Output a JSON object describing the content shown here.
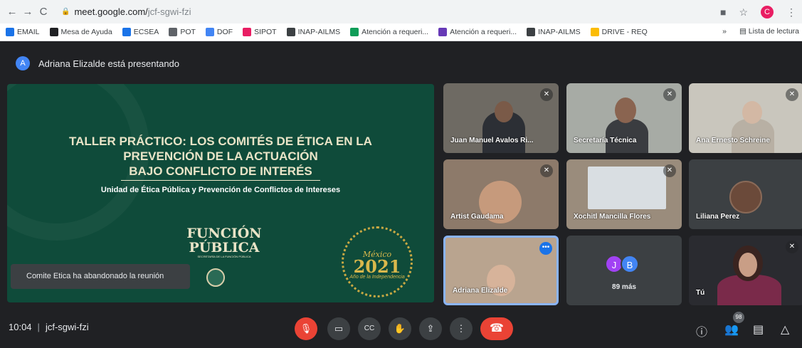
{
  "browser": {
    "url_domain": "meet.google.com/",
    "url_path": "jcf-sgwi-fzi",
    "profile_initial": "C"
  },
  "bookmarks": [
    {
      "label": "EMAIL",
      "color": "#1a73e8"
    },
    {
      "label": "Mesa de Ayuda",
      "color": "#202124"
    },
    {
      "label": "ECSEA",
      "color": "#1a73e8"
    },
    {
      "label": "POT",
      "color": "#5f6368"
    },
    {
      "label": "DOF",
      "color": "#4285f4"
    },
    {
      "label": "SIPOT",
      "color": "#e91e63"
    },
    {
      "label": "INAP-AILMS",
      "color": "#3c4043"
    },
    {
      "label": "Atención a requeri...",
      "color": "#0f9d58"
    },
    {
      "label": "Atención a requeri...",
      "color": "#673ab7"
    },
    {
      "label": "INAP-AILMS",
      "color": "#3c4043"
    },
    {
      "label": "DRIVE - REQ",
      "color": "#fbbc04"
    }
  ],
  "bookmarks_right": {
    "more": "»",
    "reading_list": "Lista de lectura"
  },
  "presenter": {
    "initial": "A",
    "text": "Adriana Elizalde está presentando"
  },
  "slide": {
    "title_lines": [
      "TALLER PRÁCTICO: LOS COMITÉS DE ÉTICA EN LA",
      "PREVENCIÓN DE LA ACTUACIÓN",
      "BAJO CONFLICTO DE INTERÉS"
    ],
    "subtitle": "Unidad de Ética Pública y Prevención de Conflictos de Intereses",
    "logo_line1": "FUNCIÓN",
    "logo_line2": "PÚBLICA",
    "logo_small": "SECRETARÍA DE LA FUNCIÓN PÚBLICA",
    "badge_mexico": "México",
    "badge_year": "2021",
    "badge_ind": "Año de la Independencia"
  },
  "toast": "Comite Etica ha abandonado la reunión",
  "participants": [
    {
      "name": "Juan Manuel Avalos Ri...",
      "muted": true
    },
    {
      "name": "Secretaría Técnica",
      "muted": true
    },
    {
      "name": "Ana Ernesto Schreine",
      "muted": true
    },
    {
      "name": "Artist Gaudama",
      "muted": true
    },
    {
      "name": "Xochitl Mancilla Flores",
      "muted": true
    },
    {
      "name": "Liliana Perez",
      "muted": false
    },
    {
      "name": "Adriana Elizalde",
      "muted": false
    },
    {
      "name": "Tú",
      "muted": true
    }
  ],
  "more_tile": {
    "bubbles": [
      "J",
      "B"
    ],
    "label": "89 más"
  },
  "bottom": {
    "time": "10:04",
    "separator": "|",
    "code": "jcf-sgwi-fzi",
    "people_badge": "98"
  },
  "colors": {
    "meet_bg": "#202124",
    "end_call": "#ea4335",
    "slide_green": "#0f4b3a"
  }
}
